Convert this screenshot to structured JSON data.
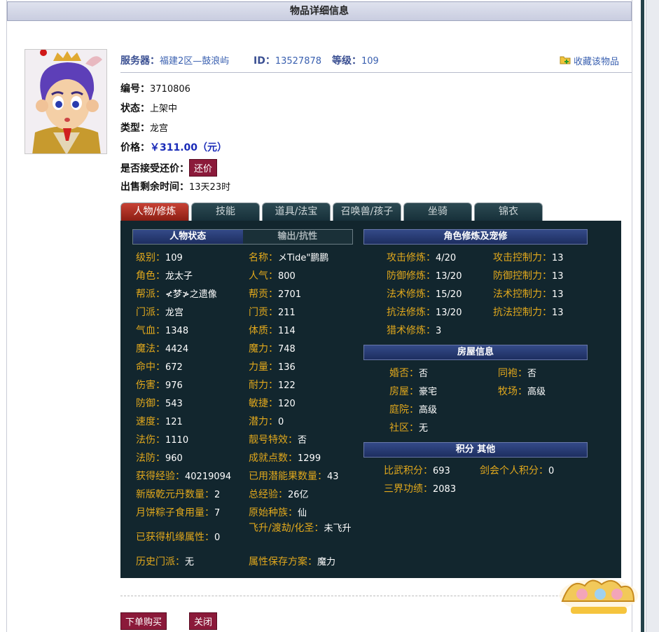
{
  "window": {
    "title": "物品详细信息"
  },
  "header": {
    "server_label": "服务器：",
    "server_value": "福建2区—鼓浪屿",
    "id_label": "ID：",
    "id_value": "13527878",
    "level_label": "等级：",
    "level_value": "109",
    "favorite_label": "收藏该物品"
  },
  "fields": {
    "number_label": "编号：",
    "number_value": "3710806",
    "status_label": "状态：",
    "status_value": "上架中",
    "type_label": "类型：",
    "type_value": "龙宫",
    "price_label": "价格：",
    "price_value": "￥311.00（元）",
    "bargain_label": "是否接受还价：",
    "bargain_button": "还价",
    "time_label": "出售剩余时间：",
    "time_value": "13天23时"
  },
  "tabs": [
    "人物/修炼",
    "技能",
    "道具/法宝",
    "召唤兽/孩子",
    "坐骑",
    "锦衣"
  ],
  "sections": {
    "char_status": "人物状态",
    "output_resist": "输出/抗性",
    "cultivation": "角色修炼及宠修",
    "house": "房屋信息",
    "points": "积分 其他"
  },
  "left_col": [
    {
      "k": "级别：",
      "v": "109"
    },
    {
      "k": "角色：",
      "v": "龙太子"
    },
    {
      "k": "帮派：",
      "v": "≮梦≯之遗像"
    },
    {
      "k": "门派：",
      "v": "龙宫"
    },
    {
      "k": "气血：",
      "v": "1348"
    },
    {
      "k": "魔法：",
      "v": "4424"
    },
    {
      "k": "命中：",
      "v": "672"
    },
    {
      "k": "伤害：",
      "v": "976"
    },
    {
      "k": "防御：",
      "v": "543"
    },
    {
      "k": "速度：",
      "v": "121"
    },
    {
      "k": "法伤：",
      "v": "1110"
    },
    {
      "k": "法防：",
      "v": "960"
    },
    {
      "k": "获得经验：",
      "v": "40219094"
    },
    {
      "k": "新版乾元丹数量：",
      "v": "2"
    },
    {
      "k": "月饼粽子食用量：",
      "v": "7"
    },
    {
      "k": "已获得机缘属性：",
      "v": "0"
    },
    {
      "k": "历史门派：",
      "v": "无"
    }
  ],
  "right_col": [
    {
      "k": "名称：",
      "v": "メTide\"鹏鹏"
    },
    {
      "k": "人气：",
      "v": "800"
    },
    {
      "k": "帮贡：",
      "v": "2701"
    },
    {
      "k": "门贡：",
      "v": "211"
    },
    {
      "k": "体质：",
      "v": "114"
    },
    {
      "k": "魔力：",
      "v": "748"
    },
    {
      "k": "力量：",
      "v": "136"
    },
    {
      "k": "耐力：",
      "v": "122"
    },
    {
      "k": "敏捷：",
      "v": "120"
    },
    {
      "k": "潜力：",
      "v": "0"
    },
    {
      "k": "靓号特效：",
      "v": "否"
    },
    {
      "k": "成就点数：",
      "v": "1299"
    },
    {
      "k": "已用潜能果数量：",
      "v": "43"
    },
    {
      "k": "总经验：",
      "v": "26亿"
    },
    {
      "k": "原始种族：",
      "v": "仙"
    },
    {
      "k": "飞升/渡劫/化圣：",
      "v": "未飞升"
    },
    {
      "k": "属性保存方案：",
      "v": "魔力"
    }
  ],
  "cultivation": [
    {
      "k1": "攻击修炼：",
      "v1": "4/20",
      "k2": "攻击控制力：",
      "v2": "13"
    },
    {
      "k1": "防御修炼：",
      "v1": "13/20",
      "k2": "防御控制力：",
      "v2": "13"
    },
    {
      "k1": "法术修炼：",
      "v1": "15/20",
      "k2": "法术控制力：",
      "v2": "13"
    },
    {
      "k1": "抗法修炼：",
      "v1": "13/20",
      "k2": "抗法控制力：",
      "v2": "13"
    },
    {
      "k1": "猎术修炼：",
      "v1": "3"
    }
  ],
  "house": [
    {
      "k1": "婚否：",
      "v1": "否",
      "k2": "同袍：",
      "v2": "否"
    },
    {
      "k1": "房屋：",
      "v1": "豪宅",
      "k2": "牧场：",
      "v2": "高级"
    },
    {
      "k1": "庭院：",
      "v1": "高级"
    },
    {
      "k1": "社区：",
      "v1": "无"
    }
  ],
  "points": [
    {
      "k1": "比武积分：",
      "v1": "693",
      "k2": "剑会个人积分：",
      "v2": "0"
    },
    {
      "k1": "三界功绩：",
      "v1": "2083"
    }
  ],
  "bottom": {
    "buy": "下单购买",
    "close": "关闭"
  },
  "colors": {
    "label_gold": "#e1a81c",
    "panel_bg": "#12262e",
    "button_red": "#8b1a3a",
    "active_tab": "#b6372b"
  },
  "icons": {
    "favorite": "folder-plus-icon"
  }
}
